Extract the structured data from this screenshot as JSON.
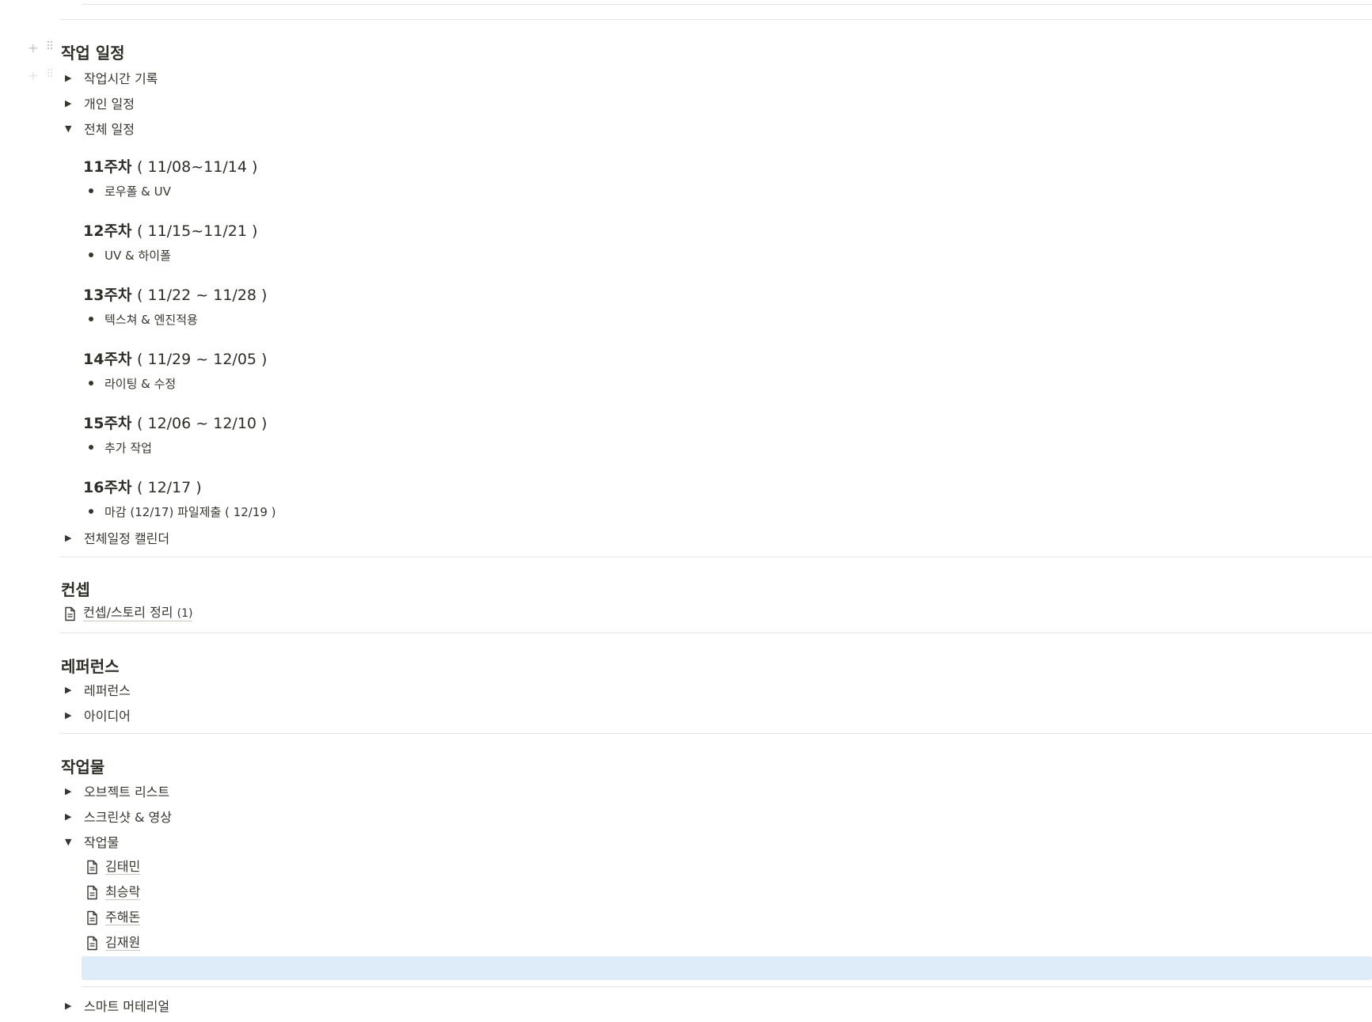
{
  "block_handles": {
    "add": "+",
    "drag": "⠿"
  },
  "sections": {
    "schedule": {
      "title": "작업 일정",
      "toggles": [
        "작업시간 기록",
        "개인 일정",
        "전체 일정"
      ],
      "weeks": [
        {
          "title": "11주차",
          "range": "( 11/08~11/14 )",
          "item": "로우폴 & UV"
        },
        {
          "title": "12주차",
          "range": "( 11/15~11/21 )",
          "item": "UV & 하이폴"
        },
        {
          "title": "13주차",
          "range": "( 11/22 ~ 11/28 )",
          "item": "텍스쳐 & 엔진적용"
        },
        {
          "title": "14주차",
          "range": "( 11/29 ~ 12/05 )",
          "item": "라이팅 & 수정"
        },
        {
          "title": "15주차",
          "range": "( 12/06 ~ 12/10 )",
          "item": "추가 작업"
        },
        {
          "title": "16주차",
          "range": "( 12/17 )",
          "item": "마감 (12/17)  파일제출 ( 12/19 )"
        }
      ],
      "calendar_toggle": "전체일정 캘린더"
    },
    "concept": {
      "title": "컨셉",
      "page_link": "컨셉/스토리 정리",
      "page_link_count": "(1)"
    },
    "reference": {
      "title": "레퍼런스",
      "toggles": [
        "레퍼런스",
        "아이디어"
      ]
    },
    "works": {
      "title": "작업물",
      "toggles": [
        "오브젝트 리스트",
        "스크린샷 & 영상",
        "작업물"
      ],
      "pages": [
        "김태민",
        "최승락",
        "주해돈",
        "김재원"
      ],
      "last_toggle": "스마트 머테리얼"
    }
  },
  "icons": {
    "collapsed": "▶",
    "expanded": "▼",
    "page": "doc-icon"
  },
  "colors": {
    "text": "#37352f",
    "divider": "#e6e6e4",
    "selection": "#deebf8"
  }
}
